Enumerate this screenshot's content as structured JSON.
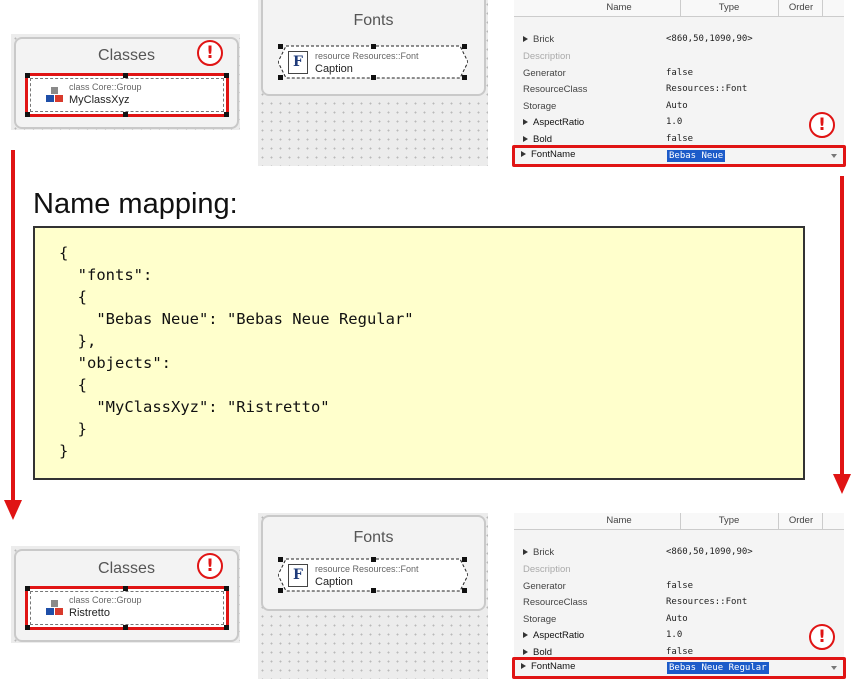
{
  "top": {
    "classes_panel": {
      "title": "Classes",
      "item_kind": "class Core::Group",
      "item_name": "MyClassXyz"
    },
    "fonts_panel": {
      "title": "Fonts",
      "item_kind": "resource Resources::Font",
      "item_name": "Caption",
      "icon_letter": "F"
    },
    "grid": {
      "columns": [
        "Name",
        "Type",
        "Order"
      ],
      "rows": [
        {
          "name": "Brick",
          "value": "<860,50,1090,90>",
          "expandable": true,
          "style": "normal"
        },
        {
          "name": "Description",
          "value": "",
          "expandable": false,
          "style": "muted"
        },
        {
          "name": "Generator",
          "value": "false",
          "expandable": false,
          "style": "normal"
        },
        {
          "name": "ResourceClass",
          "value": "Resources::Font",
          "expandable": false,
          "style": "normal"
        },
        {
          "name": "Storage",
          "value": "Auto",
          "expandable": false,
          "style": "normal"
        },
        {
          "name": "AspectRatio",
          "value": "1.0",
          "expandable": true,
          "style": "bold"
        },
        {
          "name": "Bold",
          "value": "false",
          "expandable": true,
          "style": "bold"
        }
      ],
      "highlight_row": {
        "name": "FontName",
        "value": "Bebas Neue"
      }
    }
  },
  "mapping": {
    "heading": "Name mapping:",
    "lines": [
      "{",
      "  \"fonts\":",
      "  {",
      "    \"Bebas Neue\": \"Bebas Neue Regular\"",
      "  },",
      "  \"objects\":",
      "  {",
      "    \"MyClassXyz\": \"Ristretto\"",
      "  }",
      "}"
    ]
  },
  "bottom": {
    "classes_panel": {
      "title": "Classes",
      "item_kind": "class Core::Group",
      "item_name": "Ristretto"
    },
    "fonts_panel": {
      "title": "Fonts",
      "item_kind": "resource Resources::Font",
      "item_name": "Caption",
      "icon_letter": "F"
    },
    "grid": {
      "columns": [
        "Name",
        "Type",
        "Order"
      ],
      "rows": [
        {
          "name": "Brick",
          "value": "<860,50,1090,90>",
          "expandable": true,
          "style": "normal"
        },
        {
          "name": "Description",
          "value": "",
          "expandable": false,
          "style": "muted"
        },
        {
          "name": "Generator",
          "value": "false",
          "expandable": false,
          "style": "normal"
        },
        {
          "name": "ResourceClass",
          "value": "Resources::Font",
          "expandable": false,
          "style": "normal"
        },
        {
          "name": "Storage",
          "value": "Auto",
          "expandable": false,
          "style": "normal"
        },
        {
          "name": "AspectRatio",
          "value": "1.0",
          "expandable": true,
          "style": "bold"
        },
        {
          "name": "Bold",
          "value": "false",
          "expandable": true,
          "style": "bold"
        }
      ],
      "highlight_row": {
        "name": "FontName",
        "value": "Bebas Neue Regular"
      }
    }
  },
  "icons": {
    "alert": "exclamation-circle-icon",
    "class": "class-group-icon",
    "font": "font-resource-icon",
    "expand": "triangle-right-icon",
    "dropdown": "chevron-down-icon"
  },
  "colors": {
    "accent_red": "#e01414",
    "json_bg": "#ffffcc",
    "selection_blue": "#1c5bc9"
  }
}
